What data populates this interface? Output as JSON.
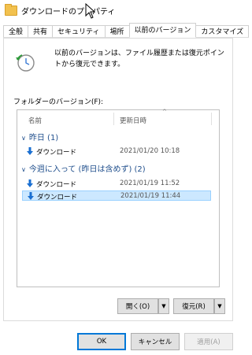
{
  "window": {
    "title": "ダウンロードのプロパティ"
  },
  "tabs": [
    {
      "label": "全般"
    },
    {
      "label": "共有"
    },
    {
      "label": "セキュリティ"
    },
    {
      "label": "場所"
    },
    {
      "label": "以前のバージョン"
    },
    {
      "label": "カスタマイズ"
    }
  ],
  "panel": {
    "description": "以前のバージョンは、ファイル履歴または復元ポイントから復元できます。",
    "folder_versions_label": "フォルダーのバージョン(F):",
    "columns": {
      "name": "名前",
      "modified": "更新日時"
    },
    "groups": [
      {
        "label": "昨日 (1)",
        "items": [
          {
            "name": "ダウンロード",
            "date": "2021/01/20 10:18",
            "selected": false
          }
        ]
      },
      {
        "label": "今週に入って (昨日は含めず) (2)",
        "items": [
          {
            "name": "ダウンロード",
            "date": "2021/01/19 11:52",
            "selected": false
          },
          {
            "name": "ダウンロード",
            "date": "2021/01/19 11:44",
            "selected": true
          }
        ]
      }
    ],
    "open_button": "開く(O)",
    "restore_button": "復元(R)"
  },
  "footer": {
    "ok": "OK",
    "cancel": "キャンセル",
    "apply": "適用(A)"
  },
  "colors": {
    "selection_bg": "#cce8ff",
    "group_text": "#1f4e8c",
    "arrow_blue": "#1a6fd1"
  }
}
